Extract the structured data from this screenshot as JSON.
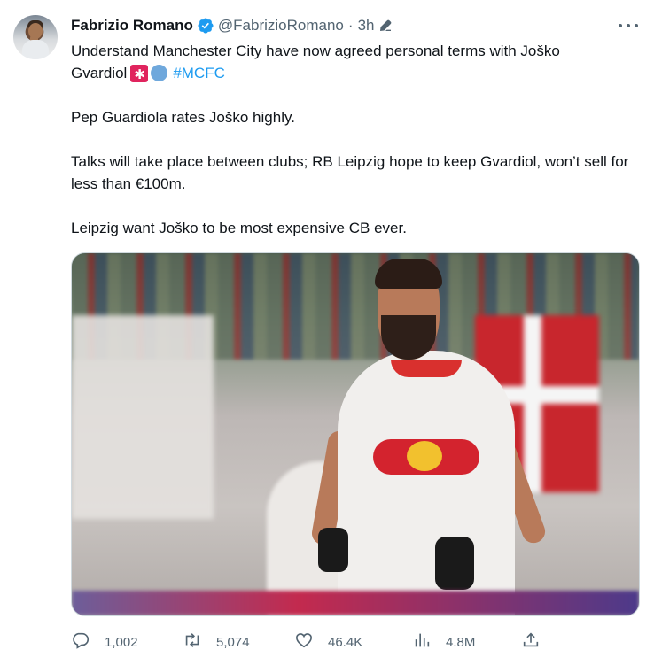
{
  "tweet": {
    "author": {
      "name": "Fabrizio Romano",
      "handle": "@FabrizioRomano",
      "verified": true,
      "avatar_icon": "profile-photo"
    },
    "separator": "·",
    "time": "3h",
    "edited_icon": "edit-pencil-icon",
    "more_icon": "more-horizontal-icon",
    "text": {
      "line1": "Understand Manchester City have now agreed personal terms with Joško",
      "line2_word": "Gvardiol",
      "emojis": [
        "siren-emoji",
        "blue-circle-emoji"
      ],
      "hashtag": "#MCFC",
      "para2": "Pep Guardiola rates Joško highly.",
      "para3": "Talks will take place between clubs; RB Leipzig hope to keep Gvardiol, won’t sell for less than €100m.",
      "para4": "Leipzig want Joško to be most expensive CB ever."
    },
    "media": {
      "description_icon": "photo-player-icon"
    },
    "actions": {
      "reply": {
        "icon": "reply-icon",
        "count": "1,002"
      },
      "retweet": {
        "icon": "retweet-icon",
        "count": "5,074"
      },
      "like": {
        "icon": "heart-icon",
        "count": "46.4K"
      },
      "views": {
        "icon": "views-icon",
        "count": "4.8M"
      },
      "share": {
        "icon": "share-icon"
      }
    },
    "colors": {
      "accent": "#1d9bf0",
      "text": "#0f1419",
      "secondary": "#536471",
      "border": "#cfd9de"
    }
  }
}
